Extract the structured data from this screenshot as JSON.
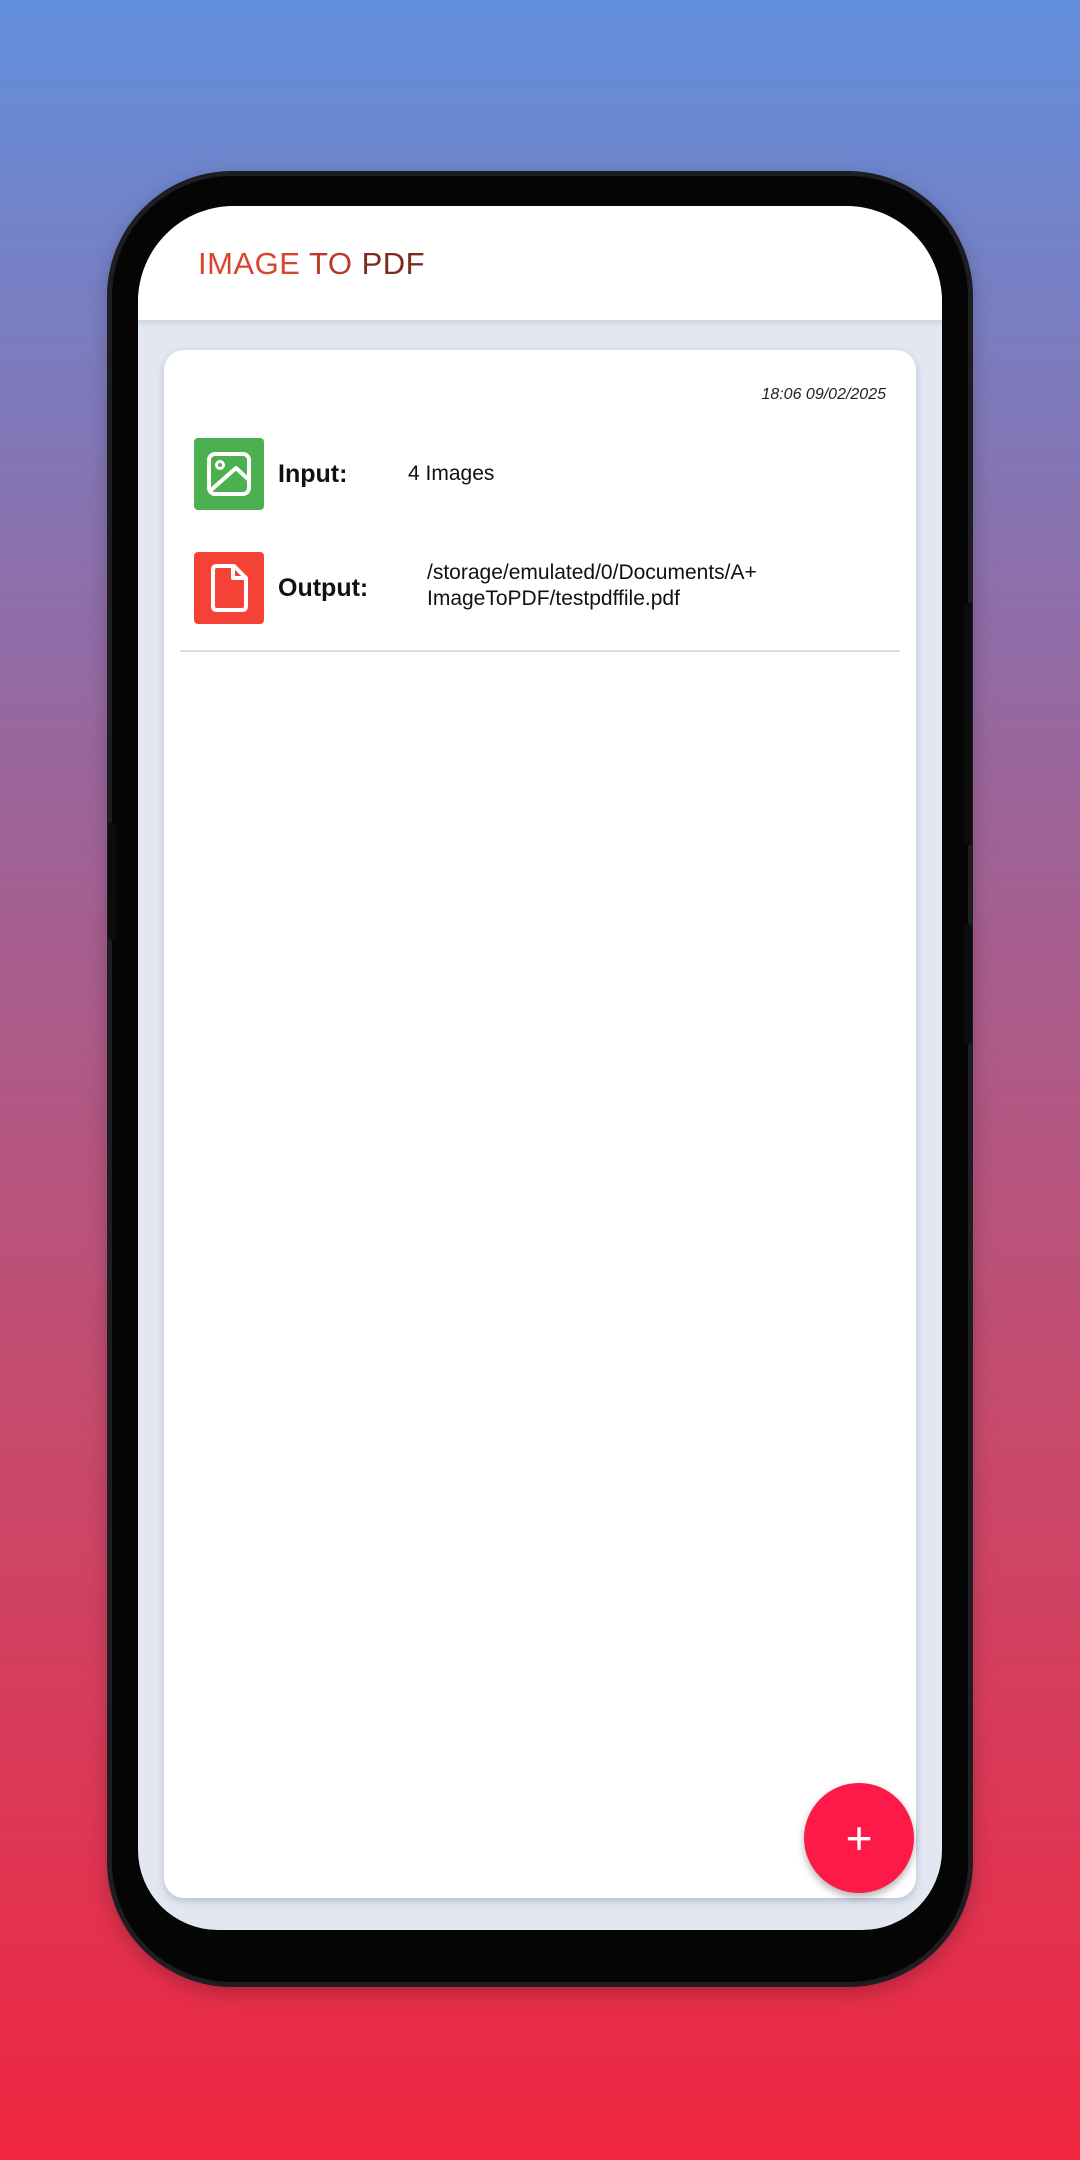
{
  "app": {
    "title_part1": "IMAGE",
    "title_part2": "TO",
    "title_part3": "PDF"
  },
  "history_item": {
    "timestamp": "18:06 09/02/2025",
    "input_label": "Input:",
    "input_value": "4 Images",
    "input_icon": "image-icon",
    "output_label": "Output:",
    "output_value_line1": "/storage/emulated/0/Documents/A+",
    "output_value_line2": "ImageToPDF/testpdffile.pdf",
    "output_icon": "file-icon"
  },
  "fab": {
    "label": "+",
    "icon": "plus-icon"
  },
  "colors": {
    "input_tile": "#4caf50",
    "output_tile": "#f44336",
    "fab": "#fd1a48"
  }
}
